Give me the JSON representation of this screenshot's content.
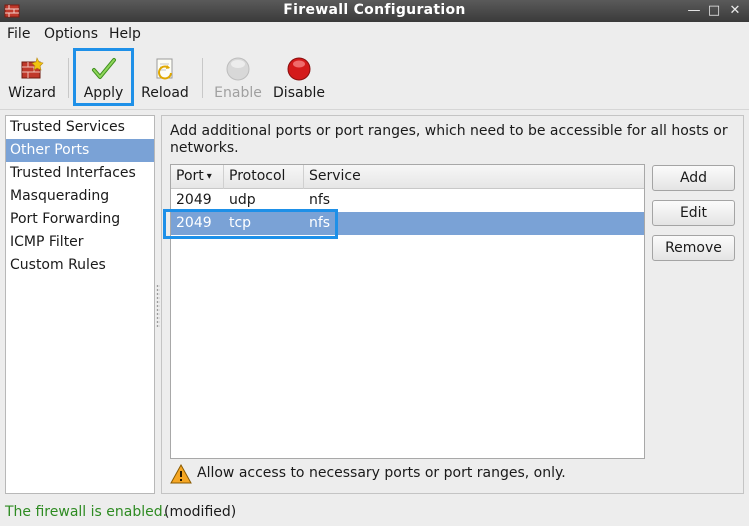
{
  "window": {
    "title": "Firewall Configuration",
    "controls": {
      "minimize": "—",
      "maximize": "□",
      "close": "✕"
    }
  },
  "menubar": {
    "items": [
      "File",
      "Options",
      "Help"
    ]
  },
  "toolbar": {
    "wizard": "Wizard",
    "apply": "Apply",
    "reload": "Reload",
    "enable": "Enable",
    "disable": "Disable"
  },
  "nav": {
    "items": [
      "Trusted Services",
      "Other Ports",
      "Trusted Interfaces",
      "Masquerading",
      "Port Forwarding",
      "ICMP Filter",
      "Custom Rules"
    ],
    "selected": "Other Ports"
  },
  "main": {
    "description": "Add additional ports or port ranges, which need to be accessible for all hosts or networks.",
    "table": {
      "columns": [
        "Port",
        "Protocol",
        "Service"
      ],
      "sort_icon": "▾",
      "rows": [
        {
          "port": "2049",
          "protocol": "udp",
          "service": "nfs"
        },
        {
          "port": "2049",
          "protocol": "tcp",
          "service": "nfs"
        }
      ],
      "selected_row": 1
    },
    "buttons": {
      "add": "Add",
      "edit": "Edit",
      "remove": "Remove"
    },
    "warning": "Allow access to necessary ports or port ranges, only."
  },
  "status": {
    "text": "The firewall is enabled.",
    "modified": "(modified)"
  },
  "colors": {
    "selection": "#7aa2d6",
    "highlight": "#1e90e8",
    "status_ok": "#2e8b22",
    "disable_red": "#d41a1a"
  }
}
